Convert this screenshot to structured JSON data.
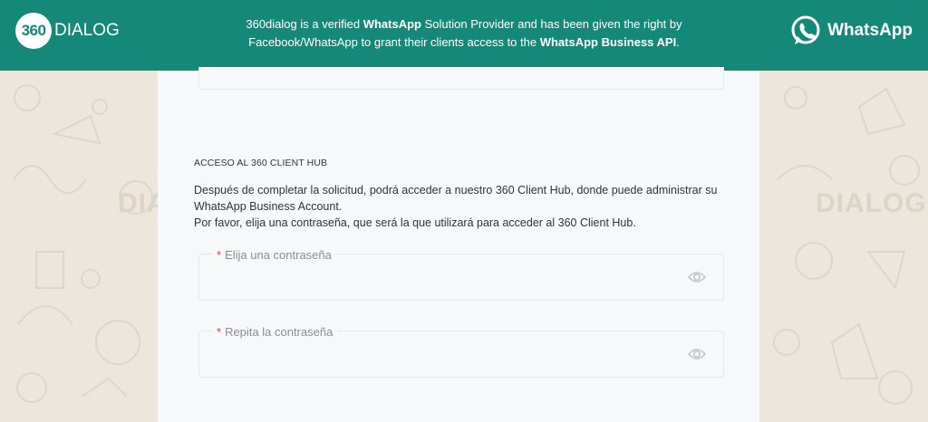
{
  "header": {
    "logo_mark": "360",
    "logo_text": "DIALOG",
    "message_parts": [
      {
        "text": "360dialog is a verified ",
        "bold": false
      },
      {
        "text": "WhatsApp",
        "bold": true
      },
      {
        "text": " Solution Provider and has been given the right by Facebook/WhatsApp to grant their clients access to the ",
        "bold": false
      },
      {
        "text": "WhatsApp Business API",
        "bold": true
      },
      {
        "text": ".",
        "bold": false
      }
    ],
    "brand_name": "WhatsApp",
    "brand_icon": "whatsapp-logo-icon"
  },
  "form": {
    "section_title": "ACCESO AL 360 CLIENT HUB",
    "description_line1": "Después de completar la solicitud, podrá acceder a nuestro 360 Client Hub, donde puede administrar su WhatsApp Business Account.",
    "description_line2": "Por favor, elija una contraseña, que será la que utilizará para acceder al 360 Client Hub.",
    "required_mark": "*",
    "password_label": "Elija una contraseña",
    "password_value": "",
    "repeat_label": "Repita la contraseña",
    "repeat_value": "",
    "eye_icon": "eye-icon"
  },
  "background": {
    "watermark_text": "DIALOG"
  },
  "colors": {
    "header_bg": "#14897a",
    "card_bg": "#f7f8fa",
    "page_bg": "#ede6dd",
    "required": "#e0393e"
  }
}
